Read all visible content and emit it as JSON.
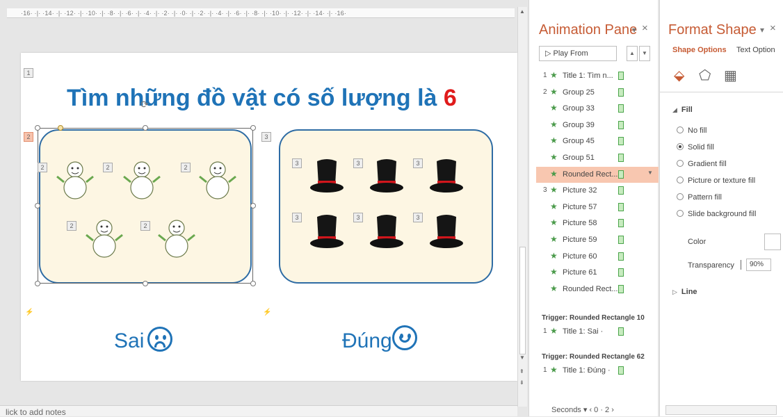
{
  "ruler": {
    "text": "·16· ·|· ·14· ·|· ·12· ·|· ·10· ·|· ·8· ·|· ·6· ·|· ·4· ·|· ·2· ·|· ·0· ·|· ·2· ·|· ·4· ·|· ·6· ·|· ·8· ·|· ·10· ·|· ·12· ·|· ·14· ·|· ·16·"
  },
  "slide": {
    "title_main": "Tìm những đồ vật có số lượng là ",
    "title_number": "6",
    "left_answer": "Sai",
    "right_answer": "Đúng",
    "tag_group": "2",
    "tag_picture": "3",
    "tag_left_box": "1",
    "tag_right_box": "3"
  },
  "notes": {
    "placeholder": "lick to add notes"
  },
  "animation_pane": {
    "title": "Animation Pane",
    "close_icon": "×",
    "pin_icon": "▾",
    "play_label": "▷  Play From",
    "items": [
      {
        "num": "1",
        "label": "Title 1: Tìm n..."
      },
      {
        "num": "2",
        "label": "Group 25"
      },
      {
        "num": "",
        "label": "Group 33"
      },
      {
        "num": "",
        "label": "Group 39"
      },
      {
        "num": "",
        "label": "Group 45"
      },
      {
        "num": "",
        "label": "Group 51"
      },
      {
        "num": "",
        "label": "Rounded Rect..."
      },
      {
        "num": "3",
        "label": "Picture 32"
      },
      {
        "num": "",
        "label": "Picture 57"
      },
      {
        "num": "",
        "label": "Picture 58"
      },
      {
        "num": "",
        "label": "Picture 59"
      },
      {
        "num": "",
        "label": "Picture 60"
      },
      {
        "num": "",
        "label": "Picture 61"
      },
      {
        "num": "",
        "label": "Rounded Rect..."
      }
    ],
    "trigger1": {
      "title": "Trigger: Rounded Rectangle 10",
      "num": "1",
      "label": "Title 1: Sai ·"
    },
    "trigger2": {
      "title": "Trigger: Rounded Rectangle 62",
      "num": "1",
      "label": "Title 1: Đúng ·"
    },
    "seconds_label": "Seconds ▾   ‹ 0 ·  2 ›"
  },
  "format_pane": {
    "title": "Format Shape",
    "close_icon": "×",
    "pin_icon": "▾",
    "tab_shape": "Shape Options",
    "tab_text": "Text Option",
    "fill_header": "Fill",
    "fill_options": [
      {
        "label": "No fill",
        "selected": false
      },
      {
        "label": "Solid fill",
        "selected": true
      },
      {
        "label": "Gradient fill",
        "selected": false
      },
      {
        "label": "Picture or texture fill",
        "selected": false
      },
      {
        "label": "Pattern fill",
        "selected": false
      },
      {
        "label": "Slide background fill",
        "selected": false
      }
    ],
    "color_label": "Color",
    "transparency_label": "Transparency",
    "transparency_value": "90%",
    "line_header": "Line"
  },
  "colors": {
    "accent": "#c65b34",
    "title_blue": "#1f73b7",
    "number_red": "#e01b1b",
    "box_fill": "#fdf6e3",
    "selected_row": "#f8c7b0"
  }
}
